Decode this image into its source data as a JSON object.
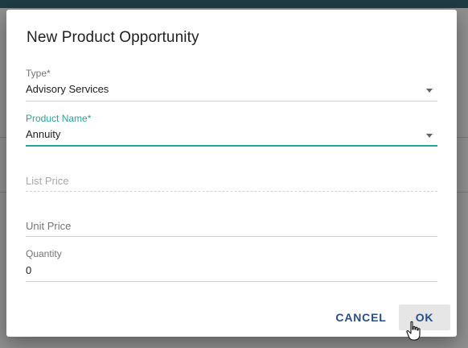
{
  "dialog": {
    "title": "New Product Opportunity",
    "fields": {
      "type": {
        "label": "Type*",
        "value": "Advisory Services"
      },
      "product_name": {
        "label": "Product Name*",
        "value": "Annuity"
      },
      "list_price": {
        "label": "List Price"
      },
      "unit_price": {
        "label": "Unit Price"
      },
      "quantity": {
        "label": "Quantity",
        "value": "0"
      }
    },
    "buttons": {
      "cancel": "CANCEL",
      "ok": "OK"
    }
  },
  "colors": {
    "accent": "#26a69a",
    "button_text": "#2a4e8a",
    "backdrop_header": "#1f3b44"
  },
  "icons": [
    "chevron-down-icon",
    "hand-pointer-icon"
  ]
}
